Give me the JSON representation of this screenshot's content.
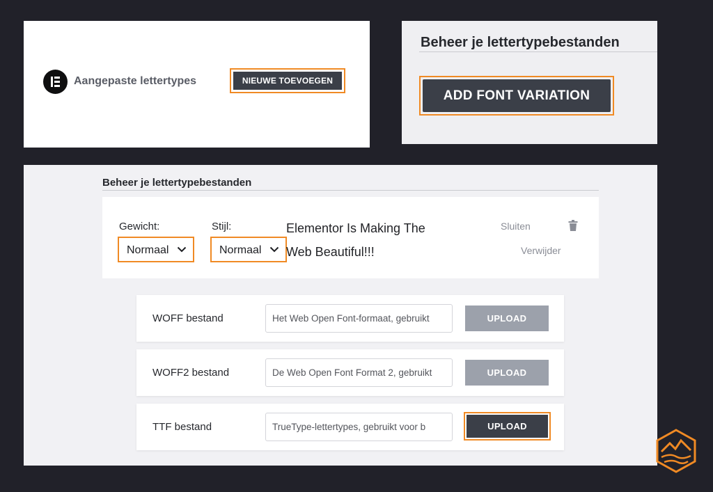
{
  "panel_a": {
    "logo_icon": "elementor-logo-icon",
    "title": "Aangepaste lettertypes",
    "add_new_button": "NIEUWE TOEVOEGEN"
  },
  "panel_b": {
    "heading": "Beheer je lettertypebestanden",
    "add_variation_button": "ADD FONT VARIATION"
  },
  "panel_c": {
    "heading": "Beheer je lettertypebestanden",
    "weight_label": "Gewicht:",
    "weight_value": "Normaal",
    "style_label": "Stijl:",
    "style_value": "Normaal",
    "preview_text": "Elementor Is Making The Web Beautiful!!!",
    "close_link": "Sluiten",
    "delete_link": "Verwijder",
    "trash_icon": "trash-icon",
    "files": [
      {
        "label": "WOFF bestand",
        "placeholder": "Het Web Open Font-formaat, gebruikt",
        "button": "UPLOAD"
      },
      {
        "label": "WOFF2 bestand",
        "placeholder": "De Web Open Font Format 2, gebruikt",
        "button": "UPLOAD"
      },
      {
        "label": "TTF bestand",
        "placeholder": "TrueType-lettertypes, gebruikt voor b",
        "button": "UPLOAD"
      }
    ]
  },
  "colors": {
    "highlight": "#f08a24",
    "dark_button": "#3b3f48",
    "disabled_button": "#9ca1ab",
    "background": "#212129"
  },
  "brand_icon": "mountain-hexagon-logo-icon"
}
